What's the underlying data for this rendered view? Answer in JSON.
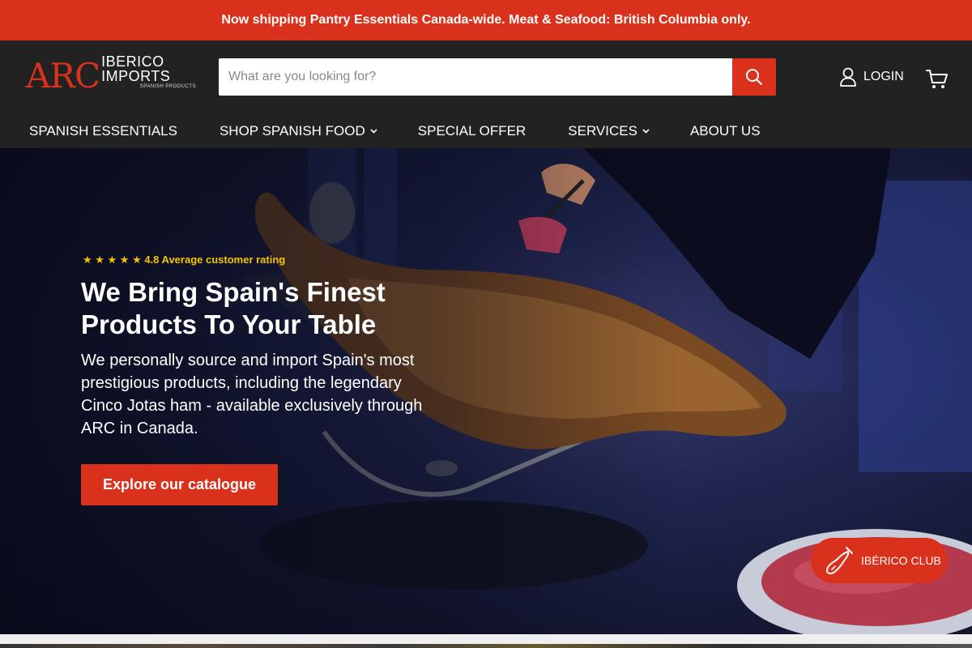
{
  "announcement": "Now shipping Pantry Essentials Canada-wide. Meat & Seafood: British Columbia only.",
  "logo": {
    "arc": "ARC",
    "name": "IBERICO IMPORTS",
    "tagline": "SPANISH PRODUCTS"
  },
  "search": {
    "placeholder": "What are you looking for?",
    "icon": "search-icon"
  },
  "account": {
    "login_label": "LOGIN",
    "user_icon": "user-icon",
    "cart_icon": "cart-icon"
  },
  "nav": {
    "items": [
      {
        "label": "SPANISH ESSENTIALS",
        "has_dropdown": false
      },
      {
        "label": "SHOP SPANISH FOOD",
        "has_dropdown": true
      },
      {
        "label": "SPECIAL OFFER",
        "has_dropdown": false
      },
      {
        "label": "SERVICES",
        "has_dropdown": true
      },
      {
        "label": "ABOUT US",
        "has_dropdown": false
      }
    ]
  },
  "hero": {
    "stars": "★ ★ ★ ★ ★",
    "rating_text": "4.8 Average customer rating",
    "title": "We Bring Spain's Finest Products To Your Table",
    "body": "We personally source and import Spain's most prestigious products, including the legendary Cinco Jotas ham - available exclusively through ARC in Canada.",
    "cta": "Explore our catalogue"
  },
  "club": {
    "label": "IBÉRICO CLUB",
    "icon": "ham-leg-icon"
  },
  "colors": {
    "brand_red": "#d9311b",
    "header_bg": "#222222",
    "rating_gold": "#f5c400"
  }
}
